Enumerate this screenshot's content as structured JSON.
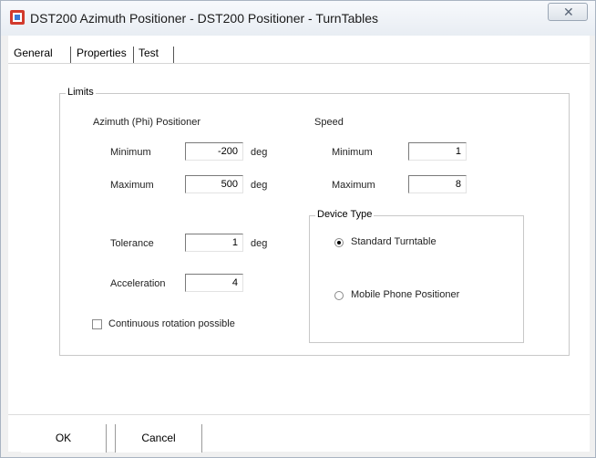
{
  "window": {
    "title": "DST200 Azimuth Positioner - DST200 Positioner - TurnTables",
    "close_icon": "close-icon"
  },
  "tabs": [
    {
      "label": "General"
    },
    {
      "label": "Properties",
      "active": true
    },
    {
      "label": "Test"
    }
  ],
  "limits": {
    "caption": "Limits",
    "azimuth": {
      "header": "Azimuth (Phi) Positioner",
      "minimum_label": "Minimum",
      "minimum_value": "-200",
      "maximum_label": "Maximum",
      "maximum_value": "500",
      "unit": "deg",
      "tolerance_label": "Tolerance",
      "tolerance_value": "1",
      "acceleration_label": "Acceleration",
      "acceleration_value": "4",
      "continuous_label": "Continuous rotation possible",
      "continuous_checked": false
    },
    "speed": {
      "header": "Speed",
      "minimum_label": "Minimum",
      "minimum_value": "1",
      "maximum_label": "Maximum",
      "maximum_value": "8"
    },
    "device_type": {
      "caption": "Device Type",
      "options": [
        {
          "label": "Standard Turntable",
          "selected": true
        },
        {
          "label": "Mobile Phone Positioner",
          "selected": false
        }
      ]
    }
  },
  "buttons": {
    "ok": "OK",
    "cancel": "Cancel"
  }
}
